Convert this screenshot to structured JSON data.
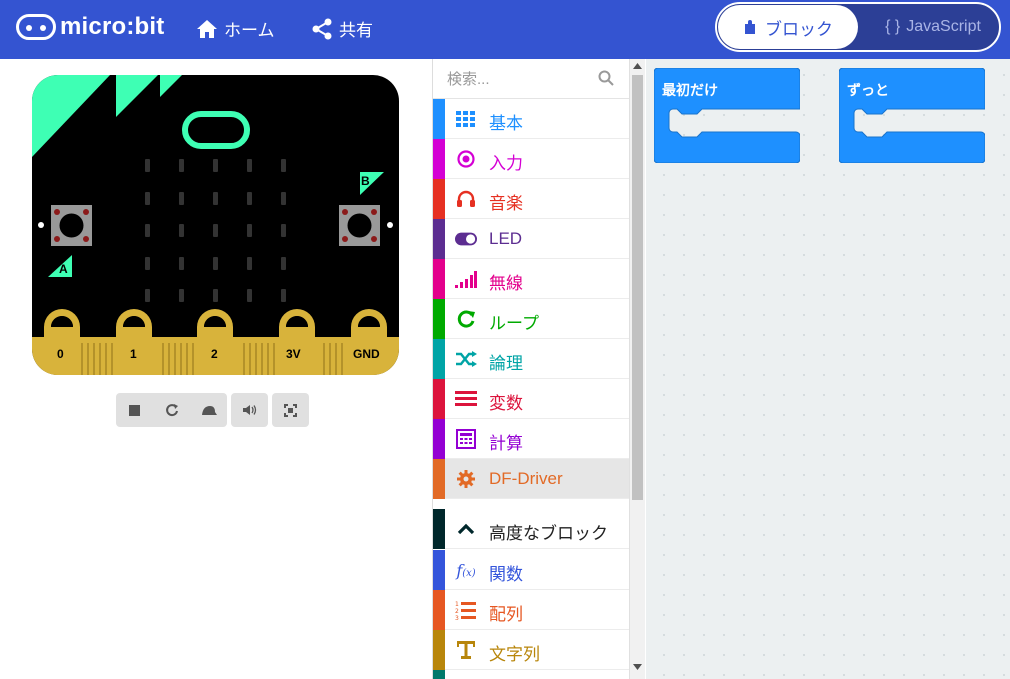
{
  "header": {
    "logo_text": "micro:bit",
    "home_label": "ホーム",
    "share_label": "共有",
    "blocks_label": "ブロック",
    "javascript_label": "JavaScript",
    "brand_color": "#3454D1"
  },
  "simulator": {
    "button_a": "A",
    "button_b": "B",
    "pins": [
      "0",
      "1",
      "2",
      "3V",
      "GND"
    ],
    "controls": [
      "stop-icon",
      "restart-icon",
      "slow-motion-icon",
      "mute-icon",
      "fullscreen-icon"
    ]
  },
  "toolbox": {
    "search_placeholder": "検索...",
    "categories": [
      {
        "label": "基本",
        "color": "#1E90FF",
        "icon": "grid-icon"
      },
      {
        "label": "入力",
        "color": "#D400D4",
        "icon": "target-icon"
      },
      {
        "label": "音楽",
        "color": "#E63022",
        "icon": "headphones-icon"
      },
      {
        "label": "LED",
        "color": "#5C2D91",
        "icon": "toggle-icon"
      },
      {
        "label": "無線",
        "color": "#E3008C",
        "icon": "signal-icon"
      },
      {
        "label": "ループ",
        "color": "#00AA00",
        "icon": "refresh-icon"
      },
      {
        "label": "論理",
        "color": "#00A4A6",
        "icon": "shuffle-icon"
      },
      {
        "label": "変数",
        "color": "#DC143C",
        "icon": "lines-icon"
      },
      {
        "label": "計算",
        "color": "#9400D3",
        "icon": "calculator-icon"
      },
      {
        "label": "DF-Driver",
        "color": "#E26A26",
        "icon": "gear-icon"
      }
    ],
    "advanced": [
      {
        "label": "高度なブロック",
        "color": "#00272B",
        "icon": "chevron-up-icon"
      },
      {
        "label": "関数",
        "color": "#3455DB",
        "icon": "function-icon"
      },
      {
        "label": "配列",
        "color": "#E65722",
        "icon": "list-numbered-icon"
      },
      {
        "label": "文字列",
        "color": "#B8860B",
        "icon": "text-icon"
      }
    ]
  },
  "workspace": {
    "on_start_label": "最初だけ",
    "forever_label": "ずっと",
    "block_color": "#1E90FF"
  }
}
